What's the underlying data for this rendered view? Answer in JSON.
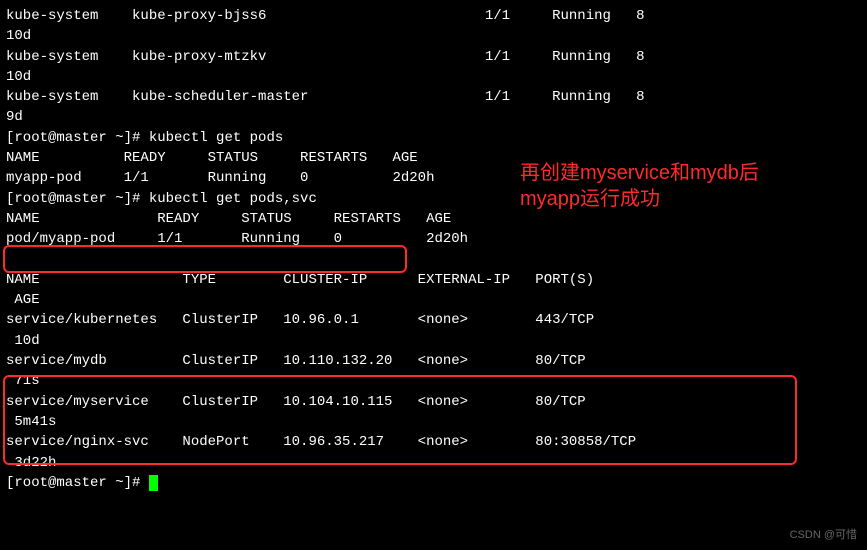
{
  "top_pods": [
    {
      "ns": "kube-system",
      "name": "kube-proxy-bjss6",
      "ready": "1/1",
      "status": "Running",
      "restarts": "8",
      "age": "10d"
    },
    {
      "ns": "kube-system",
      "name": "kube-proxy-mtzkv",
      "ready": "1/1",
      "status": "Running",
      "restarts": "8",
      "age": "10d"
    },
    {
      "ns": "kube-system",
      "name": "kube-scheduler-master",
      "ready": "1/1",
      "status": "Running",
      "restarts": "8",
      "age": "9d"
    }
  ],
  "prompts": {
    "p1": "[root@master ~]# ",
    "cmd1": "kubectl get pods",
    "p2": "[root@master ~]# ",
    "cmd2": "kubectl get pods,svc",
    "p3": "[root@master ~]# "
  },
  "pods1_header": {
    "c1": "NAME",
    "c2": "READY",
    "c3": "STATUS",
    "c4": "RESTARTS",
    "c5": "AGE"
  },
  "pods1_row": {
    "c1": "myapp-pod",
    "c2": "1/1",
    "c3": "Running",
    "c4": "0",
    "c5": "2d20h"
  },
  "pods2_header": {
    "c1": "NAME",
    "c2": "READY",
    "c3": "STATUS",
    "c4": "RESTARTS",
    "c5": "AGE"
  },
  "pods2_row": {
    "c1": "pod/myapp-pod",
    "c2": "1/1",
    "c3": "Running",
    "c4": "0",
    "c5": "2d20h"
  },
  "svc_header": {
    "c1": "NAME",
    "c2": "TYPE",
    "c3": "CLUSTER-IP",
    "c4": "EXTERNAL-IP",
    "c5": "PORT(S)",
    "c6": " AGE"
  },
  "svc_rows": [
    {
      "c1": "service/kubernetes",
      "c2": "ClusterIP",
      "c3": "10.96.0.1",
      "c4": "<none>",
      "c5": "443/TCP",
      "c6": " 10d"
    },
    {
      "c1": "service/mydb",
      "c2": "ClusterIP",
      "c3": "10.110.132.20",
      "c4": "<none>",
      "c5": "80/TCP",
      "c6": " 71s"
    },
    {
      "c1": "service/myservice",
      "c2": "ClusterIP",
      "c3": "10.104.10.115",
      "c4": "<none>",
      "c5": "80/TCP",
      "c6": " 5m41s"
    },
    {
      "c1": "service/nginx-svc",
      "c2": "NodePort",
      "c3": "10.96.35.217",
      "c4": "<none>",
      "c5": "80:30858/TCP",
      "c6": " 3d22h"
    }
  ],
  "annotation": {
    "line1": "再创建myservice和mydb后",
    "line2": "myapp运行成功"
  },
  "watermark": "CSDN @可惜"
}
